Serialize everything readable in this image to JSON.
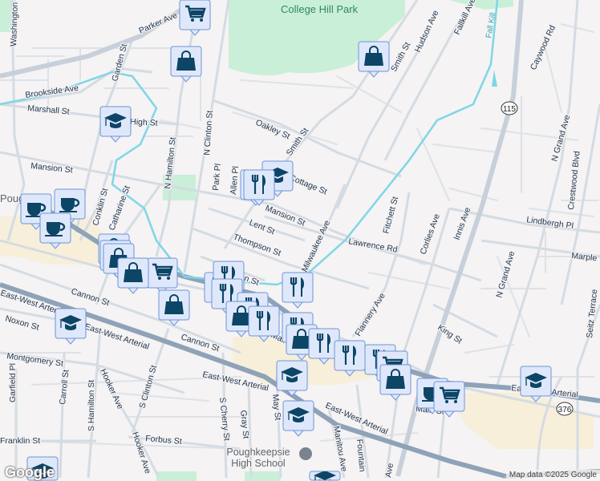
{
  "map": {
    "parks": {
      "college_hill": "College Hill Park"
    },
    "water": {
      "fall_kill": "Fall Kill"
    },
    "poi": {
      "high_school": "Poughkeepsie High School",
      "high_school_line1": "Poughkeepsie",
      "high_school_line2": "High School",
      "city_partial": "Poug"
    },
    "route_shields": [
      "115",
      "376"
    ],
    "streets": {
      "washington": "Washington St",
      "parker": "Parker Ave",
      "hamilton_top": "N Hamilton St",
      "garden": "Garden St",
      "brookside": "Brookside Ave",
      "marshall": "Marshall St",
      "high": "High St",
      "n_hamilton": "N Hamilton St",
      "n_clinton": "N Clinton St",
      "oakley": "Oakley St",
      "smith": "Smith St",
      "smith_top": "Smith St",
      "hudson": "Hudson Ave",
      "fallkill": "Fallkill Ave",
      "caywood": "Caywood Rd",
      "mansion": "Mansion St",
      "mansion2": "Mansion St",
      "park_pl": "Park Pl",
      "allen_pl": "Allen Pl",
      "cottage": "Cottage St",
      "conklin": "Conklin St",
      "catharine": "Catharine St",
      "lent": "Lent St",
      "thompson": "Thompson St",
      "harrison": "Harrison St",
      "milwaukee": "Milwaukee Ave",
      "lawrence": "Lawrence Rd",
      "fitchett": "Fitchett St",
      "corlies": "Corlies Ave",
      "innis": "Innis Ave",
      "n_grand": "N Grand Ave",
      "n_grand2": "N Grand Ave",
      "crestwood": "Crestwood Blvd",
      "lindbergh": "Lindbergh Pl",
      "marple": "Marple",
      "seitz": "Seitz Terrace",
      "flannery": "Flannery Ave",
      "king": "King St",
      "cannon": "Cannon St",
      "cannon2": "Cannon St",
      "noxon": "Noxon St",
      "ew_arterial1": "East-West Arterial",
      "ew_arterial2": "East-West Arterial",
      "ew_arterial3": "East-West Arterial",
      "ew_arterial4": "East-West Arterial",
      "ew_arterial5": "East-West Arterial",
      "montgomery": "Montgomery St",
      "garfield": "Garfield Pl",
      "carroll": "Carroll St",
      "s_hamilton": "S Hamilton St",
      "hooker": "Hooker Ave",
      "hooker2": "Hooker Ave",
      "s_clinton": "S Clinton St",
      "s_cherry": "S Cherry St",
      "gray": "Gray St",
      "may": "May St",
      "franklin": "Franklin St",
      "forbus": "Forbus St",
      "main": "Main St",
      "main2": "Main St",
      "main3": "Main St",
      "manitou": "Manitou Ave",
      "fountain": "Fountain",
      "ave_partial": "Ave"
    },
    "markers": [
      {
        "type": "cart-icon",
        "category": "grocery"
      },
      {
        "type": "bag-icon",
        "category": "shopping"
      },
      {
        "type": "bag-icon",
        "category": "shopping"
      },
      {
        "type": "school-icon",
        "category": "school"
      },
      {
        "type": "restaurant-icon",
        "category": "restaurant"
      },
      {
        "type": "school-icon",
        "category": "school"
      },
      {
        "type": "restaurant-icon",
        "category": "restaurant"
      },
      {
        "type": "coffee-icon",
        "category": "cafe"
      },
      {
        "type": "coffee-icon",
        "category": "cafe"
      },
      {
        "type": "coffee-icon",
        "category": "cafe"
      },
      {
        "type": "bag-icon",
        "category": "shopping"
      },
      {
        "type": "cart-icon",
        "category": "grocery"
      },
      {
        "type": "bag-icon",
        "category": "shopping"
      },
      {
        "type": "cart-icon",
        "category": "grocery"
      },
      {
        "type": "bag-icon",
        "category": "shopping"
      },
      {
        "type": "bag-icon",
        "category": "shopping"
      },
      {
        "type": "restaurant-icon",
        "category": "restaurant"
      },
      {
        "type": "restaurant-icon",
        "category": "restaurant"
      },
      {
        "type": "restaurant-icon",
        "category": "restaurant"
      },
      {
        "type": "restaurant-icon",
        "category": "restaurant"
      },
      {
        "type": "bag-icon",
        "category": "shopping"
      },
      {
        "type": "restaurant-icon",
        "category": "restaurant"
      },
      {
        "type": "school-icon",
        "category": "school"
      },
      {
        "type": "restaurant-icon",
        "category": "restaurant"
      },
      {
        "type": "restaurant-icon",
        "category": "restaurant"
      },
      {
        "type": "bag-icon",
        "category": "shopping"
      },
      {
        "type": "restaurant-icon",
        "category": "restaurant"
      },
      {
        "type": "restaurant-icon",
        "category": "restaurant"
      },
      {
        "type": "restaurant-icon",
        "category": "restaurant"
      },
      {
        "type": "cart-icon",
        "category": "grocery"
      },
      {
        "type": "bag-icon",
        "category": "shopping"
      },
      {
        "type": "school-icon",
        "category": "school"
      },
      {
        "type": "school-icon",
        "category": "school"
      },
      {
        "type": "coffee-icon",
        "category": "cafe"
      },
      {
        "type": "cart-icon",
        "category": "grocery"
      },
      {
        "type": "school-icon",
        "category": "school"
      },
      {
        "type": "school-icon",
        "category": "school"
      },
      {
        "type": "school-icon",
        "category": "school"
      }
    ]
  },
  "branding": {
    "logo": "Google",
    "attribution": "Map data ©2025 Google"
  }
}
